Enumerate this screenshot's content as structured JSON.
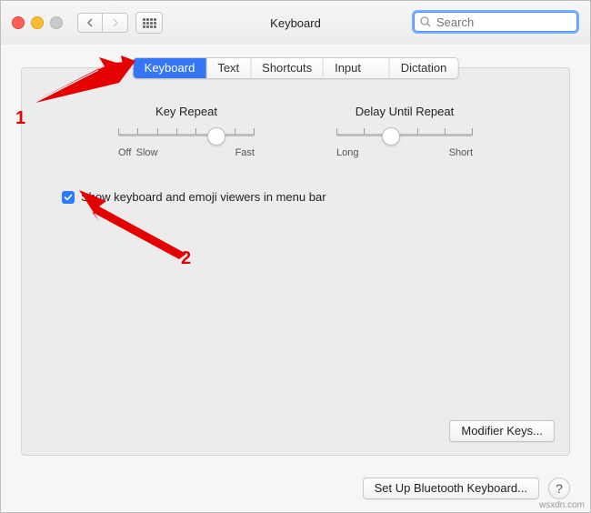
{
  "window": {
    "title": "Keyboard"
  },
  "search": {
    "placeholder": "Search",
    "value": ""
  },
  "tabs": [
    "Keyboard",
    "Text",
    "Shortcuts",
    "Input Sources",
    "Dictation"
  ],
  "active_tab": 0,
  "key_repeat": {
    "label": "Key Repeat",
    "min_label": "Off",
    "mid_label": "Slow",
    "max_label": "Fast",
    "ticks": 8,
    "value_pct": 72
  },
  "delay_repeat": {
    "label": "Delay Until Repeat",
    "min_label": "Long",
    "max_label": "Short",
    "ticks": 6,
    "value_pct": 40
  },
  "checkbox": {
    "checked": true,
    "label": "Show keyboard and emoji viewers in menu bar"
  },
  "buttons": {
    "modifier": "Modifier Keys...",
    "bluetooth": "Set Up Bluetooth Keyboard...",
    "help": "?"
  },
  "annotations": {
    "one": "1",
    "two": "2"
  },
  "watermark": "wsxdn.com"
}
